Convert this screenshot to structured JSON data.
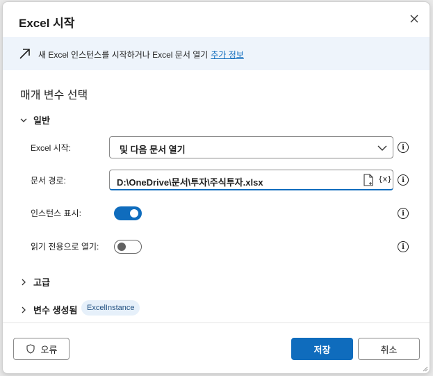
{
  "header": {
    "title": "Excel 시작"
  },
  "banner": {
    "text": "새 Excel 인스턴스를 시작하거나 Excel 문서 열기",
    "link": "추가 정보"
  },
  "section": {
    "title": "매개 변수 선택"
  },
  "general": {
    "title": "일반",
    "launch_label": "Excel 시작:",
    "launch_value": "및 다음 문서 열기",
    "path_label": "문서 경로:",
    "path_value": "D:\\OneDrive\\문서\\투자\\주식투자.xlsx",
    "var_icon_text": "{x}",
    "show_instance_label": "인스턴스 표시:",
    "show_instance_on": true,
    "readonly_label": "읽기 전용으로 열기:",
    "readonly_on": false
  },
  "advanced": {
    "title": "고급"
  },
  "variables": {
    "title": "변수 생성됨",
    "badge": "ExcelInstance"
  },
  "footer": {
    "error_label": "오류",
    "save_label": "저장",
    "cancel_label": "취소"
  },
  "colors": {
    "accent": "#0f6cbd",
    "banner_bg": "#eef4fb",
    "badge_bg": "#e6f0fa"
  },
  "icons": {
    "close": "close-icon",
    "banner": "arrow-up-right-icon",
    "chevron": "chevron-icon",
    "file": "file-icon",
    "info": "info-icon",
    "shield": "shield-icon"
  }
}
